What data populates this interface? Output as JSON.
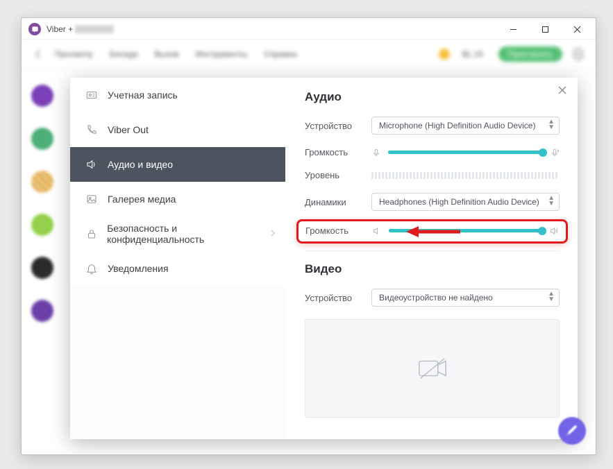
{
  "window": {
    "title_prefix": "Viber + "
  },
  "toolbar": {
    "items": [
      "Просмотр",
      "Беседа",
      "Вызов",
      "Инструменты",
      "Справка"
    ],
    "balance": "$1.15",
    "cta": "Пригласить"
  },
  "sidebar": {
    "items": [
      {
        "label": "Учетная запись",
        "icon": "id-icon"
      },
      {
        "label": "Viber Out",
        "icon": "phone-out-icon"
      },
      {
        "label": "Аудио и видео",
        "icon": "speaker-icon",
        "active": true
      },
      {
        "label": "Галерея медиа",
        "icon": "gallery-icon"
      },
      {
        "label": "Безопасность и конфиденциальность",
        "icon": "lock-icon",
        "chevron": true
      },
      {
        "label": "Уведомления",
        "icon": "bell-icon"
      }
    ]
  },
  "settings": {
    "audio": {
      "heading": "Аудио",
      "device_label": "Устройство",
      "device_value": "Microphone (High Definition Audio Device)",
      "mic_volume_label": "Громкость",
      "mic_volume_pct": 100,
      "level_label": "Уровень",
      "speakers_label": "Динамики",
      "speakers_value": "Headphones (High Definition Audio Device)",
      "spk_volume_label": "Громкость",
      "spk_volume_pct": 100
    },
    "video": {
      "heading": "Видео",
      "device_label": "Устройство",
      "device_value": "Видеоустройство не найдено"
    }
  },
  "colors": {
    "accent": "#33c1c9",
    "highlight": "#e11b1b",
    "nav_active": "#4c5460"
  }
}
